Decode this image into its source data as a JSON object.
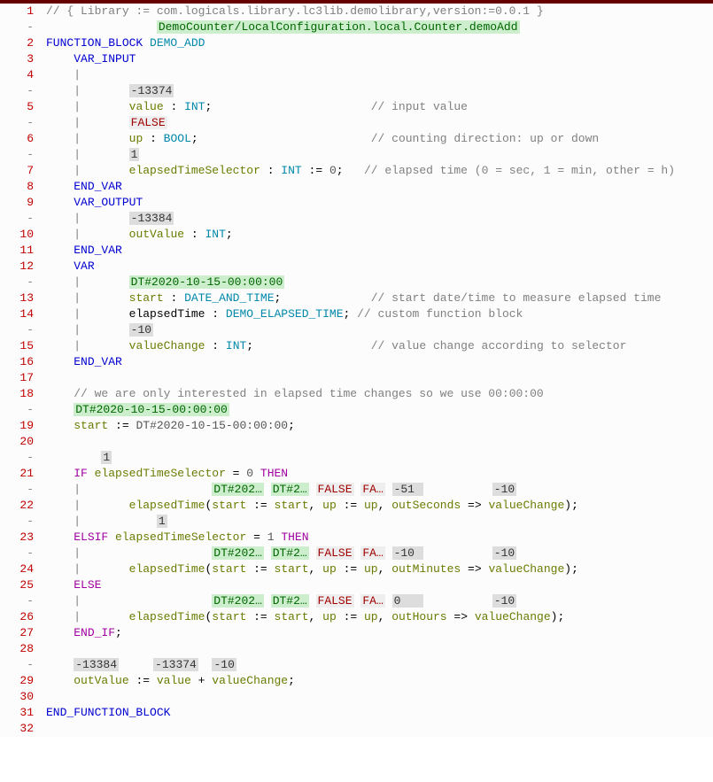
{
  "header_comment": "// { Library := com.logicals.library.lc3lib.demolibrary,version:=0.0.1 }",
  "path_anno": "DemoCounter/LocalConfiguration.local.Counter.demoAdd",
  "fb_keyword": "FUNCTION_BLOCK",
  "fb_name": "DEMO_ADD",
  "var_input": "VAR_INPUT",
  "var_output": "VAR_OUTPUT",
  "var_plain": "VAR",
  "end_var": "END_VAR",
  "end_fb": "END_FUNCTION_BLOCK",
  "anno": {
    "neg13374": "-13374",
    "FALSE": "FALSE",
    "one": "1",
    "neg13384": "-13384",
    "dt": "DT#2020-10-15-00:00:00",
    "neg10": "-10",
    "dtshort1": "DT#202…",
    "dtshort2": "DT#2…",
    "false2": "FALSE",
    "fa": "FA…",
    "neg51": "-51",
    "zero": "0"
  },
  "lines": {
    "value_decl_name": "value",
    "int_type": "INT",
    "bool_type": "BOOL",
    "date_type": "DATE_AND_TIME",
    "demo_type": "DEMO_ELAPSED_TIME",
    "value_comment": "// input value",
    "up_name": "up",
    "up_comment": "// counting direction: up or down",
    "elapsed_sel_name": "elapsedTimeSelector",
    "elapsed_sel_init": "0",
    "elapsed_sel_comment": "// elapsed time (0 = sec, 1 = min, other = h)",
    "outvalue_name": "outValue",
    "start_name": "start",
    "start_comment": "// start date/time to measure elapsed time",
    "elapsedtime_name": "elapsedTime",
    "elapsedtime_comment": "// custom function block",
    "valuechange_name": "valueChange",
    "valuechange_comment": "// value change according to selector",
    "interest_comment": "// we are only interested in elapsed time changes so we use 00:00:00",
    "assign_dt": "DT#2020-10-15-00:00:00",
    "if_kw": "IF",
    "elsif_kw": "ELSIF",
    "else_kw": "ELSE",
    "endif_kw": "END_IF",
    "then_kw": "THEN",
    "eq0": "0",
    "eq1": "1",
    "call_outseconds": "outSeconds",
    "call_outminutes": "outMinutes",
    "call_outhours": "outHours",
    "assign_op": ":=",
    "arrow_op": "=>",
    "plus": "+"
  },
  "gutter": [
    "1",
    "-",
    "2",
    "3",
    "4",
    "-",
    "5",
    "-",
    "6",
    "-",
    "7",
    "8",
    "9",
    "-",
    "10",
    "11",
    "12",
    "-",
    "13",
    "14",
    "-",
    "15",
    "16",
    "17",
    "18",
    "-",
    "19",
    "20",
    "-",
    "21",
    "-",
    "22",
    "-",
    "23",
    "-",
    "24",
    "25",
    "-",
    "26",
    "27",
    "28",
    "-",
    "29",
    "30",
    "31",
    "32"
  ]
}
